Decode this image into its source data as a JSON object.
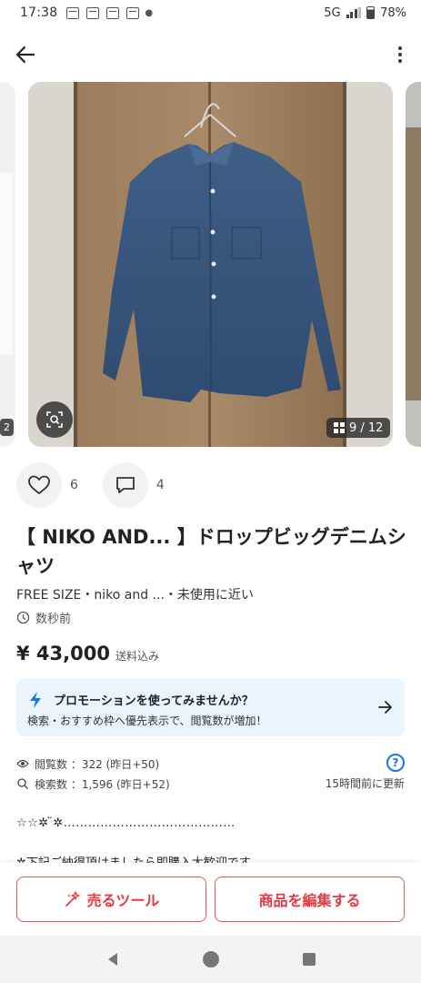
{
  "status_bar": {
    "time": "17:38",
    "network": "5G",
    "battery": "78%"
  },
  "carousel": {
    "prev_counter": "2",
    "counter": "9 / 12"
  },
  "engagement": {
    "likes": "6",
    "comments": "4"
  },
  "item": {
    "title": "【 NIKO AND... 】ドロップビッグデニムシャツ",
    "meta": "FREE SIZE・niko and ...・未使用に近い",
    "posted": "数秒前",
    "price": "¥ 43,000",
    "shipping": "送料込み"
  },
  "promo": {
    "title": "プロモーションを使ってみませんか？",
    "description": "検索・おすすめ枠へ優先表示で、閲覧数が増加！"
  },
  "stats": {
    "views": "閲覧数 ：322 (昨日+50)",
    "searches": "検索数 ：1,596 (昨日+52)",
    "updated": "15時間前に更新",
    "help": "?"
  },
  "description": {
    "line1": "☆☆✲ ̈✲……………………………………",
    "line2": "✲下記ご納得頂けましたら即購入大歓迎です"
  },
  "buttons": {
    "sell_tools": "売るツール",
    "edit_item": "商品を編集する"
  },
  "colors": {
    "accent_red": "#e43a3f",
    "promo_bg": "#eaf4fd",
    "link_blue": "#1a73e8"
  }
}
